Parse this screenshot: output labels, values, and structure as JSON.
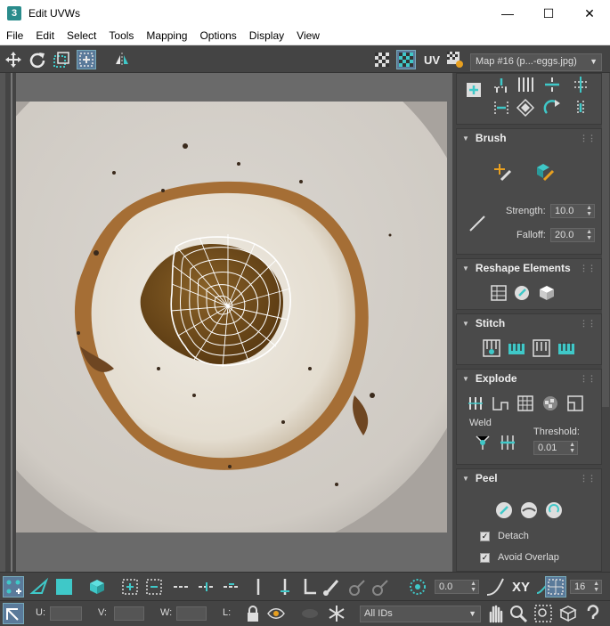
{
  "window": {
    "title": "Edit UVWs",
    "app_icon": "3"
  },
  "menu": [
    "File",
    "Edit",
    "Select",
    "Tools",
    "Mapping",
    "Options",
    "Display",
    "View"
  ],
  "toolbar": {
    "uv_label": "UV",
    "map_select": "Map #16 (p...-eggs.jpg)"
  },
  "panel": {
    "brush": {
      "title": "Brush",
      "strength_label": "Strength:",
      "strength_value": "10.0",
      "falloff_label": "Falloff:",
      "falloff_value": "20.0"
    },
    "reshape": {
      "title": "Reshape Elements"
    },
    "stitch": {
      "title": "Stitch"
    },
    "explode": {
      "title": "Explode",
      "weld_label": "Weld",
      "threshold_label": "Threshold:",
      "threshold_value": "0.01"
    },
    "peel": {
      "title": "Peel",
      "detach_label": "Detach",
      "avoid_overlap_label": "Avoid Overlap"
    }
  },
  "bottom": {
    "angle_value": "0.0",
    "xy_label": "XY",
    "snap_value": "16",
    "u_label": "U:",
    "v_label": "V:",
    "w_label": "W:",
    "l_label": "L:",
    "ids_select": "All IDs"
  },
  "colors": {
    "accent": "#3fc8c8",
    "background": "#444444"
  }
}
